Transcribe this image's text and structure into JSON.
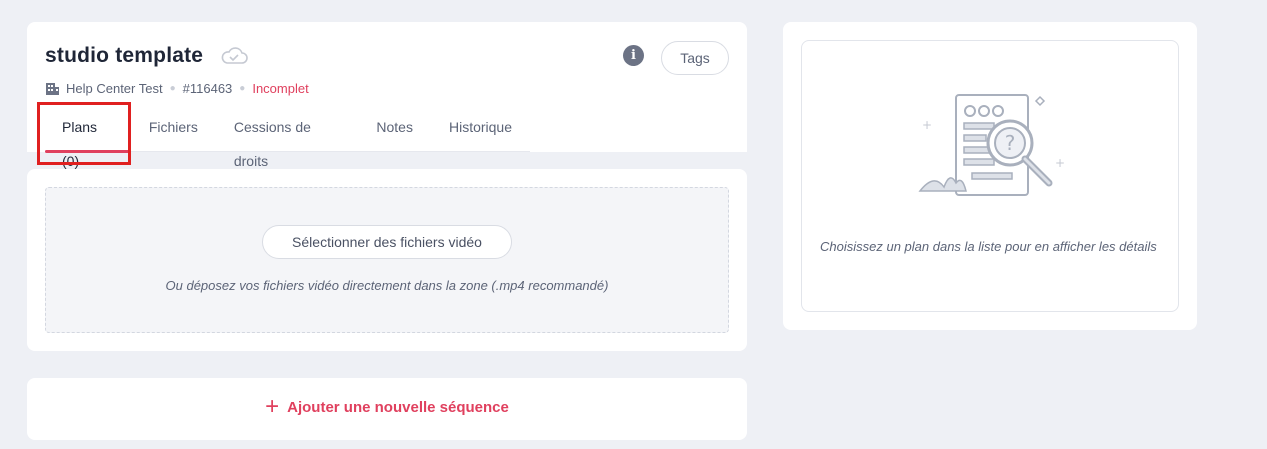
{
  "header": {
    "title": "studio template",
    "project": "Help Center Test",
    "id": "#116463",
    "status": "Incomplet",
    "tags_label": "Tags",
    "info_icon": "i"
  },
  "tabs": [
    {
      "label": "Plans (0)",
      "active": true
    },
    {
      "label": "Fichiers",
      "active": false
    },
    {
      "label": "Cessions de droits",
      "active": false
    },
    {
      "label": "Notes",
      "active": false
    },
    {
      "label": "Historique",
      "active": false
    }
  ],
  "upload": {
    "button_label": "Sélectionner des fichiers vidéo",
    "hint": "Ou déposez vos fichiers vidéo directement dans la zone (.mp4 recommandé)"
  },
  "add_sequence": {
    "plus": "+",
    "label": "Ajouter une nouvelle séquence"
  },
  "detail": {
    "hint": "Choisissez un plan dans la liste pour en afficher les détails"
  },
  "colors": {
    "accent": "#e0405e",
    "highlight_box": "#e02020",
    "background": "#eef0f5"
  },
  "icons": [
    "cloud-icon",
    "building-icon",
    "info-icon",
    "plus-icon",
    "search-document-illustration"
  ]
}
